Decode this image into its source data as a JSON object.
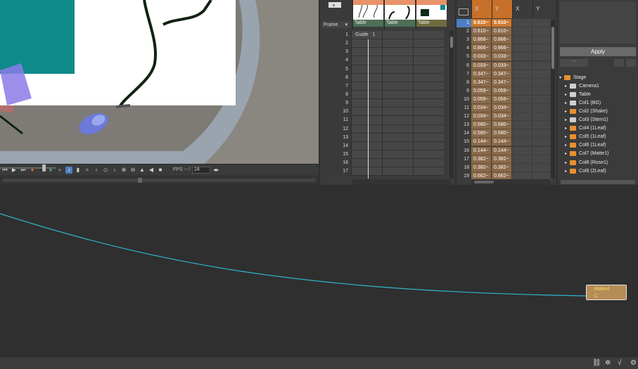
{
  "viewer": {
    "fps_label": "FPS -- /",
    "fps_value": "24"
  },
  "xsheet": {
    "frame_header": "Frame",
    "guide_label": "Guide",
    "guide_number": "1",
    "columns": [
      {
        "name": "Table",
        "color": "#e8936a"
      },
      {
        "name": "Table",
        "color": "#e8936a"
      },
      {
        "name": "Table",
        "color": "#e8936a"
      }
    ],
    "frames": [
      "1",
      "2",
      "3",
      "4",
      "5",
      "6",
      "7",
      "8",
      "9",
      "10",
      "11",
      "12",
      "13",
      "14",
      "15",
      "16",
      "17"
    ]
  },
  "function_sheet": {
    "headers": [
      "X",
      "Y",
      "X",
      "Y"
    ],
    "rows": [
      {
        "n": "1",
        "x": "0.610~",
        "y": "0.610~"
      },
      {
        "n": "2",
        "x": "0.610~",
        "y": "0.610~"
      },
      {
        "n": "3",
        "x": "0.866~",
        "y": "0.866~"
      },
      {
        "n": "4",
        "x": "0.866~",
        "y": "0.866~"
      },
      {
        "n": "5",
        "x": "0.033~",
        "y": "0.033~"
      },
      {
        "n": "6",
        "x": "0.033~",
        "y": "0.033~"
      },
      {
        "n": "7",
        "x": "0.347~",
        "y": "0.347~"
      },
      {
        "n": "8",
        "x": "0.347~",
        "y": "0.347~"
      },
      {
        "n": "9",
        "x": "0.059~",
        "y": "0.059~"
      },
      {
        "n": "10",
        "x": "0.059~",
        "y": "0.059~"
      },
      {
        "n": "11",
        "x": "0.034~",
        "y": "0.034~"
      },
      {
        "n": "12",
        "x": "0.034~",
        "y": "0.034~"
      },
      {
        "n": "13",
        "x": "0.580~",
        "y": "0.580~"
      },
      {
        "n": "14",
        "x": "0.580~",
        "y": "0.580~"
      },
      {
        "n": "15",
        "x": "0.144~",
        "y": "0.144~"
      },
      {
        "n": "16",
        "x": "0.144~",
        "y": "0.144~"
      },
      {
        "n": "17",
        "x": "0.382~",
        "y": "0.382~"
      },
      {
        "n": "18",
        "x": "0.382~",
        "y": "0.382~"
      },
      {
        "n": "19",
        "x": "0.662~",
        "y": "0.662~"
      }
    ]
  },
  "tree": {
    "apply_label": "Apply",
    "items": [
      {
        "label": "Stage",
        "kind": "root"
      },
      {
        "label": "Camera1",
        "kind": "gray"
      },
      {
        "label": "Table",
        "kind": "gray"
      },
      {
        "label": "Col1 (BG)",
        "kind": "gray"
      },
      {
        "label": "Col2 (Shake)",
        "kind": "orange"
      },
      {
        "label": "Col3 (Stem1)",
        "kind": "gray"
      },
      {
        "label": "Col4 (1Leaf)",
        "kind": "orange"
      },
      {
        "label": "Col5 (1Leaf)",
        "kind": "orange"
      },
      {
        "label": "Col6 (1Leaf)",
        "kind": "orange"
      },
      {
        "label": "Col7 (Matte1)",
        "kind": "orange"
      },
      {
        "label": "Col8 (Rose1)",
        "kind": "orange"
      },
      {
        "label": "Col9 (2Leaf)",
        "kind": "orange"
      }
    ]
  },
  "schematic": {
    "node_name": "Matte4",
    "node_port": "C"
  }
}
